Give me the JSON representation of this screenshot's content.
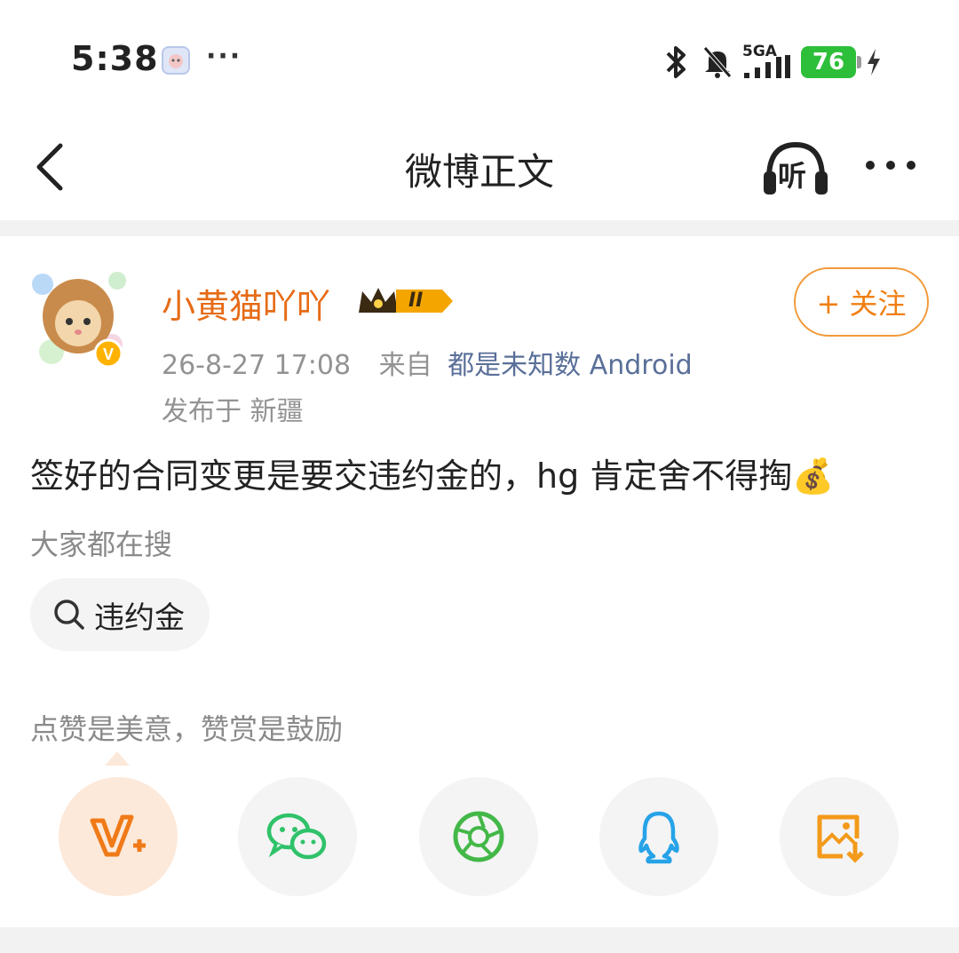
{
  "status_bar": {
    "time": "5:38",
    "more": "···",
    "network": "5GA",
    "battery": "76",
    "icons": [
      "bluetooth-icon",
      "bell-muted-icon",
      "signal-icon",
      "battery-icon",
      "charging-icon"
    ]
  },
  "nav": {
    "title": "微博正文",
    "listen_label": "听"
  },
  "post": {
    "username": "小黄猫吖吖",
    "badge_text": "II",
    "follow_label": "+ 关注",
    "time": "26-8-27 17:08",
    "from_label": "来自",
    "source": "都是未知数 Android",
    "location": "发布于 新疆",
    "text": "签好的合同变更是要交违约金的，hg 肯定舍不得掏💰",
    "search_label": "大家都在搜",
    "search_term": "违约金",
    "praise_text": "点赞是美意，赞赏是鼓励"
  },
  "share_targets": [
    "vip-plus-icon",
    "wechat-icon",
    "moments-icon",
    "qq-icon",
    "save-image-icon"
  ],
  "colors": {
    "username": "#e66b16",
    "follow": "#f07f12",
    "source": "#5a6f99",
    "battery": "#2dbf3a",
    "wechat": "#2fc26a",
    "moments": "#43b848",
    "qq": "#26a3e8",
    "save": "#f39a1a"
  }
}
